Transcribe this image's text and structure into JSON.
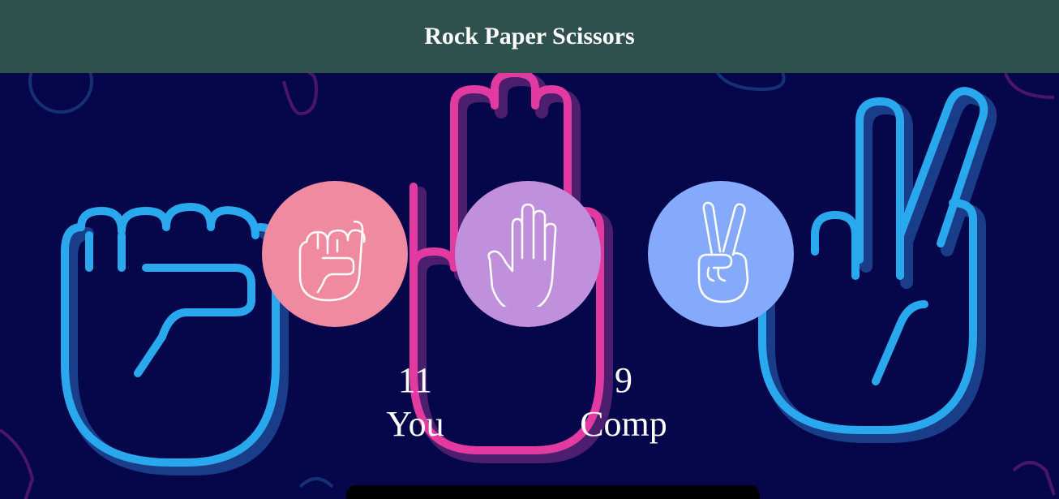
{
  "header": {
    "title": "Rock Paper Scissors",
    "background": "#2f514d"
  },
  "choices": [
    {
      "id": "rock",
      "icon": "fist-icon",
      "color": "#ef8aa0"
    },
    {
      "id": "paper",
      "icon": "open-hand-icon",
      "color": "#c190dc"
    },
    {
      "id": "scissors",
      "icon": "peace-hand-icon",
      "color": "#85aafc"
    }
  ],
  "scores": {
    "user": {
      "value": "11",
      "label": "You"
    },
    "comp": {
      "value": "9",
      "label": "Comp"
    }
  },
  "colors": {
    "background": "#05074a",
    "neon_blue": "#2aa8ee",
    "neon_pink": "#e23aa0",
    "message_bar": "#000000"
  }
}
